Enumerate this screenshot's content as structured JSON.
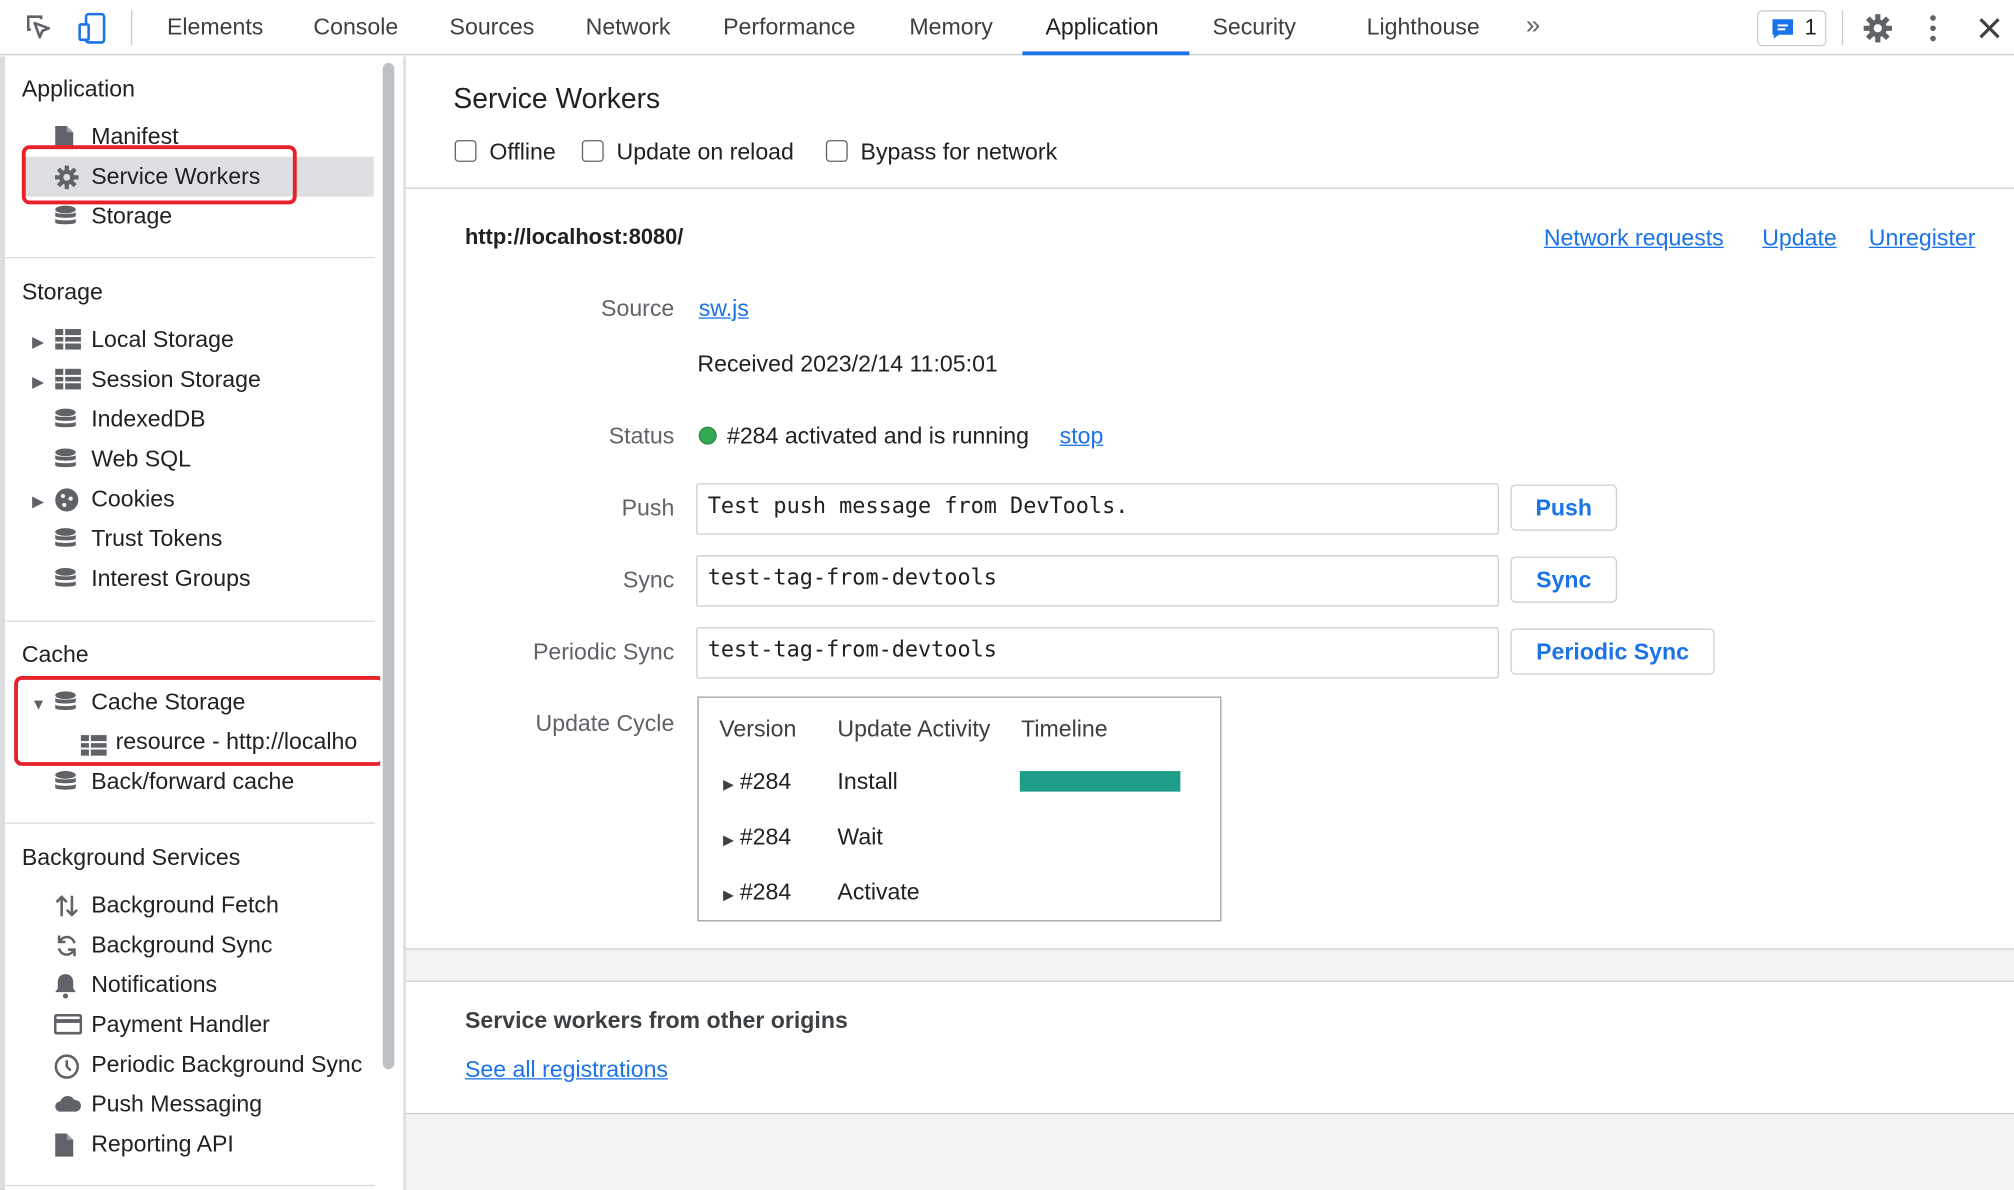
{
  "toolbar": {
    "tabs": [
      "Elements",
      "Console",
      "Sources",
      "Network",
      "Performance",
      "Memory",
      "Application",
      "Security",
      "Lighthouse"
    ],
    "active_tab": "Application",
    "more_label": "»",
    "issues_count": "1"
  },
  "sidebar": {
    "application": {
      "title": "Application",
      "items": [
        "Manifest",
        "Service Workers",
        "Storage"
      ]
    },
    "storage": {
      "title": "Storage",
      "items": [
        "Local Storage",
        "Session Storage",
        "IndexedDB",
        "Web SQL",
        "Cookies",
        "Trust Tokens",
        "Interest Groups"
      ]
    },
    "cache": {
      "title": "Cache",
      "items": [
        "Cache Storage",
        "resource - http://localho",
        "Back/forward cache"
      ]
    },
    "background": {
      "title": "Background Services",
      "items": [
        "Background Fetch",
        "Background Sync",
        "Notifications",
        "Payment Handler",
        "Periodic Background Sync",
        "Push Messaging",
        "Reporting API"
      ]
    }
  },
  "main": {
    "title": "Service Workers",
    "checkboxes": [
      "Offline",
      "Update on reload",
      "Bypass for network"
    ],
    "origin": "http://localhost:8080/",
    "actions": [
      "Network requests",
      "Update",
      "Unregister"
    ],
    "source_label": "Source",
    "source_file": "sw.js",
    "received": "Received 2023/2/14 11:05:01",
    "status_label": "Status",
    "status_text": "#284 activated and is running",
    "stop_label": "stop",
    "push_label": "Push",
    "push_value": "Test push message from DevTools.",
    "push_button": "Push",
    "sync_label": "Sync",
    "sync_value": "test-tag-from-devtools",
    "sync_button": "Sync",
    "periodic_label": "Periodic Sync",
    "periodic_value": "test-tag-from-devtools",
    "periodic_button": "Periodic Sync",
    "update_cycle_label": "Update Cycle",
    "update_cycle": {
      "headers": [
        "Version",
        "Update Activity",
        "Timeline"
      ],
      "rows": [
        {
          "version": "#284",
          "activity": "Install"
        },
        {
          "version": "#284",
          "activity": "Wait"
        },
        {
          "version": "#284",
          "activity": "Activate"
        }
      ]
    },
    "other_origins_title": "Service workers from other origins",
    "see_all_link": "See all registrations"
  },
  "colors": {
    "accent": "#1a73e8",
    "highlight": "#e8202a",
    "running": "#34a853",
    "timeline": "#1e9e88"
  }
}
